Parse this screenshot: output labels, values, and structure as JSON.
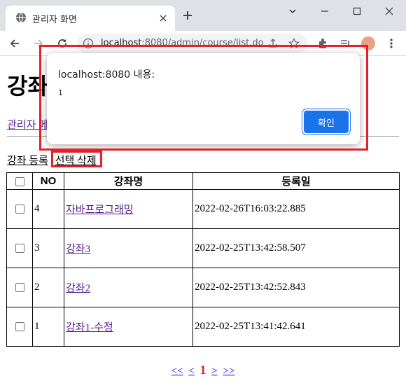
{
  "browser": {
    "tab_title": "관리자 화면",
    "url_host": "localhost",
    "url_path": ":8080/admin/course/list.do"
  },
  "page": {
    "title": "강좌",
    "admin_link": "관리자 메인",
    "add_link": "강좌 등록",
    "delete_link": "선택 삭제"
  },
  "table": {
    "headers": {
      "no": "NO",
      "name": "강좌명",
      "date": "등록일"
    },
    "rows": [
      {
        "no": "4",
        "name": "자바프로그래밍",
        "date": "2022-02-26T16:03:22.885"
      },
      {
        "no": "3",
        "name": "강좌3",
        "date": "2022-02-25T13:42:58.507"
      },
      {
        "no": "2",
        "name": "강좌2",
        "date": "2022-02-25T13:42:52.843"
      },
      {
        "no": "1",
        "name": "강좌1-수정",
        "date": "2022-02-25T13:41:42.641"
      }
    ]
  },
  "pagination": {
    "first": "<<",
    "prev": "<",
    "current": "1",
    "next": ">",
    "last": ">>"
  },
  "alert": {
    "title": "localhost:8080 내용:",
    "message": "1",
    "ok_label": "확인"
  },
  "colors": {
    "accent": "#1a73e8",
    "highlight": "#e3212b",
    "visited_link": "#551a8b",
    "link": "#0000ee"
  }
}
